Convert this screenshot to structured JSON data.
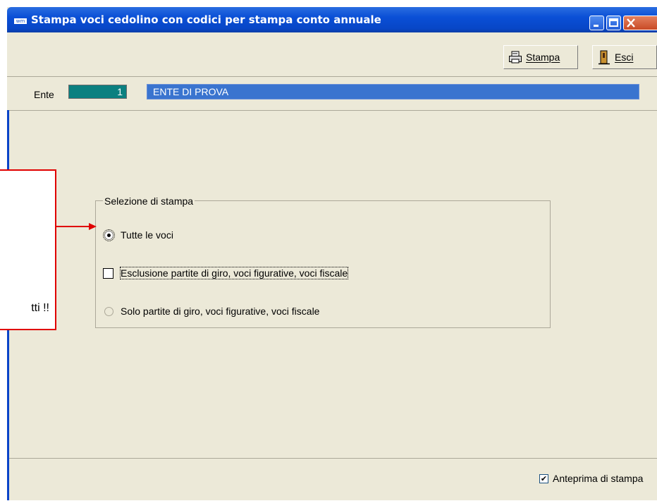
{
  "window": {
    "title": "Stampa voci cedolino con codici per stampa conto annuale",
    "app_icon_label": "wm"
  },
  "toolbar": {
    "stampa_label": "Stampa",
    "esci_label": "Esci"
  },
  "ente": {
    "label": "Ente",
    "code": "1",
    "name": "ENTE DI PROVA"
  },
  "selection": {
    "legend": "Selezione di stampa",
    "option_all": "Tutte le voci",
    "option_exclude": "Esclusione partite di giro, voci figurative, voci fiscale",
    "option_only": "Solo partite di giro, voci figurative, voci fiscale",
    "selected": "option_all"
  },
  "footer": {
    "anteprima_label": "Anteprima di stampa",
    "anteprima_checked": true
  },
  "annotation": {
    "text": "tti !!",
    "color": "#e00000"
  }
}
